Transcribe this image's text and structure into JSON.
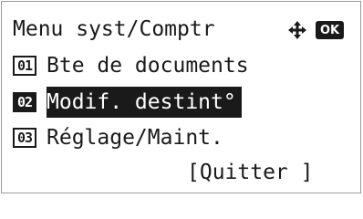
{
  "header": {
    "title": "Menu syst/Comptr",
    "nav_icon": "four-way-arrow-icon",
    "ok_label": "OK"
  },
  "menu": {
    "items": [
      {
        "number": "01",
        "label": "Bte de documents",
        "selected": false
      },
      {
        "number": "02",
        "label": "Modif. destint°",
        "selected": true
      },
      {
        "number": "03",
        "label": "Réglage/Maint.",
        "selected": false
      }
    ]
  },
  "footer": {
    "quit_label": "[Quitter ]"
  },
  "colors": {
    "foreground": "#1a1a1a",
    "background": "#ffffff",
    "border": "#9a9a9a"
  }
}
